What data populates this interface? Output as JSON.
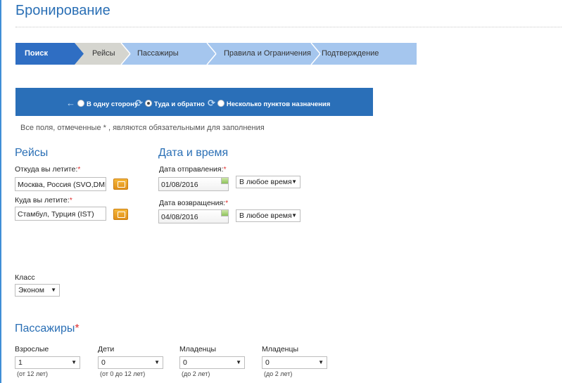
{
  "page": {
    "title": "Бронирование"
  },
  "steps": [
    {
      "label": "Поиск",
      "state": "active"
    },
    {
      "label": "Рейсы",
      "state": "done"
    },
    {
      "label": "Пассажиры",
      "state": "todo"
    },
    {
      "label": "Правила и Ограничения",
      "state": "todo"
    },
    {
      "label": "Подтверждение",
      "state": "todo"
    }
  ],
  "trip_type": {
    "options": [
      {
        "label": "В одну сторону",
        "icon": "one-way-arrow-icon",
        "selected": false
      },
      {
        "label": "Туда и обратно",
        "icon": "round-trip-arrows-icon",
        "selected": true
      },
      {
        "label": "Несколько пунктов назначения",
        "icon": "multi-city-arrows-icon",
        "selected": false
      }
    ]
  },
  "required_note": "Все поля, отмеченные * , являются обязательными для заполнения",
  "flights": {
    "title": "Рейсы",
    "from_label": "Откуда вы летите:",
    "from_value": "Москва, Россия (SVO,DME",
    "to_label": "Куда вы летите:",
    "to_value": "Стамбул, Турция (IST)",
    "required_mark": "*"
  },
  "datetime": {
    "title": "Дата и время",
    "depart_label": "Дата отправления:",
    "depart_date": "01/08/2016",
    "depart_time": "В любое время",
    "return_label": "Дата возвращения:",
    "return_date": "04/08/2016",
    "return_time": "В любое время",
    "required_mark": "*"
  },
  "cabin": {
    "label": "Класс",
    "value": "Эконом"
  },
  "passengers": {
    "title": "Пассажиры",
    "required_mark": "*",
    "groups": [
      {
        "label": "Взрослые",
        "value": "1",
        "hint": "(от 12 лет)"
      },
      {
        "label": "Дети",
        "value": "0",
        "hint": "(от 0 до 12 лет)"
      },
      {
        "label": "Младенцы",
        "value": "0",
        "hint": "(до 2 лет)"
      },
      {
        "label": "Младенцы",
        "value": "0",
        "hint": "(до 2 лет)"
      }
    ]
  },
  "colors": {
    "accent": "#2a6fb5",
    "step_active": "#2f6ec3",
    "step_done": "#d5d5cf",
    "step_todo": "#a5c6ee",
    "trip_bar": "#2a6fb8",
    "required": "#e03030",
    "button": "#f0a52a"
  }
}
